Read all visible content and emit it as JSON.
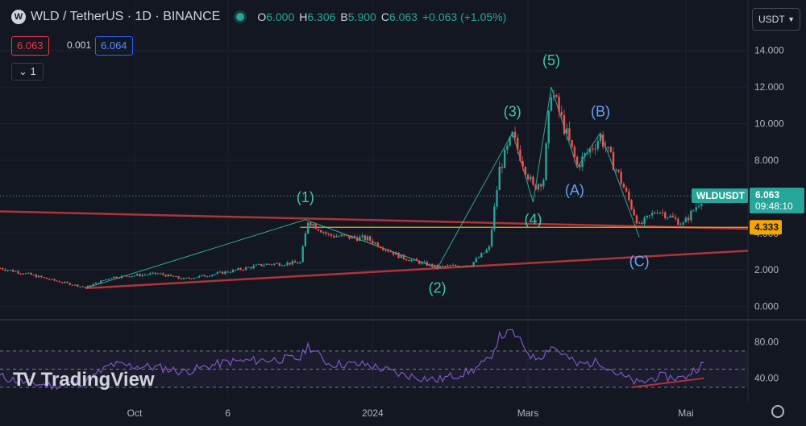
{
  "header": {
    "symbol_title": "WLD / TetherUS · 1D · BINANCE",
    "logo_text": "W",
    "ohlc": [
      {
        "key": "O",
        "value": "6.000"
      },
      {
        "key": "H",
        "value": "6.306"
      },
      {
        "key": "B",
        "value": "5.900"
      },
      {
        "key": "C",
        "value": "6.063"
      },
      {
        "key": "",
        "value": "+0.063 (+1.05%)"
      }
    ]
  },
  "trade": {
    "sell_price": "6.063",
    "spread": "0.001",
    "buy_price": "6.064"
  },
  "indicators_toggle": {
    "label": "1",
    "icon": "chevron-down-icon"
  },
  "currency_selector": {
    "label": "USDT",
    "icon": "chevron-down-icon"
  },
  "watermark": {
    "text": "TradingView",
    "logo": "TV"
  },
  "colors": {
    "background": "#131722",
    "up": "#26a69a",
    "down": "#ef5350",
    "trendline": "#b2323a",
    "hline": "#f7a600",
    "rsi": "#7e57c2",
    "wave_impulse": "#3ec9a7",
    "wave_correction": "#6b9ef5",
    "tag_bg": "#26a69a",
    "hline_tag": "#f7a600"
  },
  "chart_data": [
    {
      "type": "candlestick",
      "title": "WLD / TetherUS · 1D · BINANCE",
      "ylim": [
        -0.5,
        15.0
      ],
      "y_ticks": [
        0,
        2,
        4,
        6,
        8,
        10,
        12,
        14
      ],
      "y_tick_labels": [
        "0.000",
        "2.000",
        "4.000",
        "6.000",
        "8.000",
        "10.000",
        "12.000",
        "14.000"
      ],
      "x_ticks": [
        {
          "date": "2023-10-01",
          "label": "Oct"
        },
        {
          "date": "2023-11-06",
          "label": "6"
        },
        {
          "date": "2024-01-01",
          "label": "2024"
        },
        {
          "date": "2024-03-01",
          "label": "Mars"
        },
        {
          "date": "2024-05-01",
          "label": "Mai"
        }
      ],
      "x_range": [
        "2023-08-10",
        "2024-05-25"
      ],
      "grid": true,
      "price_path": [
        {
          "date": "2023-08-10",
          "value": 2.1
        },
        {
          "date": "2023-08-20",
          "value": 1.8
        },
        {
          "date": "2023-08-30",
          "value": 1.45
        },
        {
          "date": "2023-09-12",
          "value": 1.05
        },
        {
          "date": "2023-09-22",
          "value": 1.6
        },
        {
          "date": "2023-10-10",
          "value": 1.8
        },
        {
          "date": "2023-10-20",
          "value": 1.5
        },
        {
          "date": "2023-11-06",
          "value": 1.9
        },
        {
          "date": "2023-11-20",
          "value": 2.3
        },
        {
          "date": "2023-12-04",
          "value": 2.4
        },
        {
          "date": "2023-12-07",
          "value": 4.7
        },
        {
          "date": "2023-12-15",
          "value": 3.9
        },
        {
          "date": "2023-12-30",
          "value": 3.7
        },
        {
          "date": "2024-01-12",
          "value": 2.7
        },
        {
          "date": "2024-01-26",
          "value": 2.15
        },
        {
          "date": "2024-02-08",
          "value": 2.3
        },
        {
          "date": "2024-02-15",
          "value": 3.2
        },
        {
          "date": "2024-02-19",
          "value": 7.5
        },
        {
          "date": "2024-02-24",
          "value": 9.3
        },
        {
          "date": "2024-03-03",
          "value": 6.5
        },
        {
          "date": "2024-03-07",
          "value": 7.0
        },
        {
          "date": "2024-03-10",
          "value": 11.9
        },
        {
          "date": "2024-03-20",
          "value": 7.7
        },
        {
          "date": "2024-03-29",
          "value": 9.3
        },
        {
          "date": "2024-04-05",
          "value": 7.2
        },
        {
          "date": "2024-04-13",
          "value": 4.4
        },
        {
          "date": "2024-04-20",
          "value": 5.3
        },
        {
          "date": "2024-04-30",
          "value": 4.5
        },
        {
          "date": "2024-05-08",
          "value": 6.06
        }
      ],
      "last_price": {
        "symbol": "WLDUSDT",
        "value": "6.063",
        "countdown": "09:48:10",
        "price": 6.063
      },
      "horizontal_line": {
        "label": "4.333",
        "value": 4.333
      },
      "trendlines": [
        {
          "from": {
            "date": "2023-08-10",
            "value": 5.2
          },
          "to": {
            "date": "2024-05-25",
            "value": 4.25
          }
        },
        {
          "from": {
            "date": "2023-09-12",
            "value": 1.0
          },
          "to": {
            "date": "2024-05-25",
            "value": 3.05
          }
        }
      ],
      "wave_labels": [
        {
          "label": "(1)",
          "date": "2023-12-06",
          "value": 5.7,
          "group": "impulse"
        },
        {
          "label": "(2)",
          "date": "2024-01-26",
          "value": 0.75,
          "group": "impulse"
        },
        {
          "label": "(3)",
          "date": "2024-02-24",
          "value": 10.4,
          "group": "impulse"
        },
        {
          "label": "(4)",
          "date": "2024-03-03",
          "value": 4.5,
          "group": "impulse"
        },
        {
          "label": "(5)",
          "date": "2024-03-10",
          "value": 13.2,
          "group": "impulse"
        },
        {
          "label": "(A)",
          "date": "2024-03-19",
          "value": 6.1,
          "group": "correction"
        },
        {
          "label": "(B)",
          "date": "2024-03-29",
          "value": 10.4,
          "group": "correction"
        },
        {
          "label": "(C)",
          "date": "2024-04-13",
          "value": 2.2,
          "group": "correction"
        }
      ],
      "wave_path": [
        {
          "date": "2023-09-12",
          "value": 1.0
        },
        {
          "date": "2023-12-06",
          "value": 4.75
        },
        {
          "date": "2024-01-26",
          "value": 2.1
        },
        {
          "date": "2024-02-24",
          "value": 9.5
        },
        {
          "date": "2024-03-03",
          "value": 5.7
        },
        {
          "date": "2024-03-10",
          "value": 12.0
        },
        {
          "date": "2024-03-20",
          "value": 7.6
        },
        {
          "date": "2024-03-29",
          "value": 9.5
        },
        {
          "date": "2024-04-13",
          "value": 3.8
        }
      ]
    },
    {
      "type": "line",
      "title": "",
      "ylim": [
        22,
        100
      ],
      "y_ticks": [
        40,
        80
      ],
      "y_tick_labels": [
        "40.00",
        "80.00"
      ],
      "levels": [
        30,
        50,
        70
      ],
      "series": [
        {
          "values": [
            {
              "date": "2023-08-10",
              "value": 42
            },
            {
              "date": "2023-08-20",
              "value": 35
            },
            {
              "date": "2023-08-30",
              "value": 32
            },
            {
              "date": "2023-09-12",
              "value": 36
            },
            {
              "date": "2023-09-22",
              "value": 55
            },
            {
              "date": "2023-10-10",
              "value": 52
            },
            {
              "date": "2023-10-20",
              "value": 47
            },
            {
              "date": "2023-11-06",
              "value": 58
            },
            {
              "date": "2023-11-20",
              "value": 60
            },
            {
              "date": "2023-12-04",
              "value": 62
            },
            {
              "date": "2023-12-07",
              "value": 76
            },
            {
              "date": "2023-12-15",
              "value": 56
            },
            {
              "date": "2023-12-30",
              "value": 55
            },
            {
              "date": "2024-01-12",
              "value": 44
            },
            {
              "date": "2024-01-26",
              "value": 38
            },
            {
              "date": "2024-02-08",
              "value": 48
            },
            {
              "date": "2024-02-15",
              "value": 60
            },
            {
              "date": "2024-02-19",
              "value": 86
            },
            {
              "date": "2024-02-24",
              "value": 91
            },
            {
              "date": "2024-03-03",
              "value": 62
            },
            {
              "date": "2024-03-07",
              "value": 66
            },
            {
              "date": "2024-03-10",
              "value": 76
            },
            {
              "date": "2024-03-20",
              "value": 55
            },
            {
              "date": "2024-03-29",
              "value": 58
            },
            {
              "date": "2024-04-05",
              "value": 44
            },
            {
              "date": "2024-04-13",
              "value": 34
            },
            {
              "date": "2024-04-20",
              "value": 42
            },
            {
              "date": "2024-04-30",
              "value": 40
            },
            {
              "date": "2024-05-08",
              "value": 57
            }
          ]
        }
      ],
      "divergence_line": {
        "from": {
          "date": "2024-04-10",
          "value": 30
        },
        "to": {
          "date": "2024-05-08",
          "value": 40
        }
      }
    }
  ]
}
